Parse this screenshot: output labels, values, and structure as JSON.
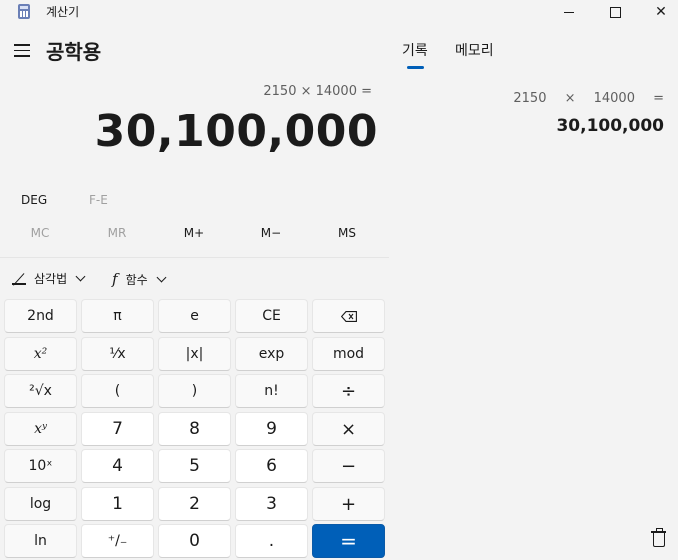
{
  "window": {
    "title": "계산기",
    "app_icon": "calculator-icon",
    "minimize_icon": "minimize-icon",
    "maximize_icon": "maximize-icon",
    "close_icon": "close-icon",
    "close_glyph": "✕"
  },
  "header": {
    "menu_icon": "hamburger-icon",
    "mode": "공학용",
    "tabs": [
      {
        "label": "기록",
        "active": true
      },
      {
        "label": "메모리",
        "active": false
      }
    ],
    "accent_color": "#005fb8"
  },
  "display": {
    "expression": "2150 × 14000 =",
    "result": "30,100,000"
  },
  "angle_row": {
    "deg": "DEG",
    "fe": "F-E"
  },
  "memory_row": [
    "MC",
    "MR",
    "M+",
    "M−",
    "MS"
  ],
  "function_row": {
    "trig": "삼각법",
    "trig_icon": "triangle-icon",
    "func": "함수",
    "func_icon_glyph": "f"
  },
  "keypad": [
    [
      "2nd",
      "π",
      "e",
      "CE",
      "backspace"
    ],
    [
      "x²",
      "¹⁄x",
      "|x|",
      "exp",
      "mod"
    ],
    [
      "²√x",
      "(",
      ")",
      "n!",
      "÷"
    ],
    [
      "xʸ",
      "7",
      "8",
      "9",
      "×"
    ],
    [
      "10ˣ",
      "4",
      "5",
      "6",
      "−"
    ],
    [
      "log",
      "1",
      "2",
      "3",
      "+"
    ],
    [
      "ln",
      "⁺/₋",
      "0",
      ".",
      "="
    ]
  ],
  "history": {
    "items": [
      {
        "expression": "2150 × 14000 =",
        "result": "30,100,000"
      }
    ],
    "delete_icon": "trash-icon"
  }
}
